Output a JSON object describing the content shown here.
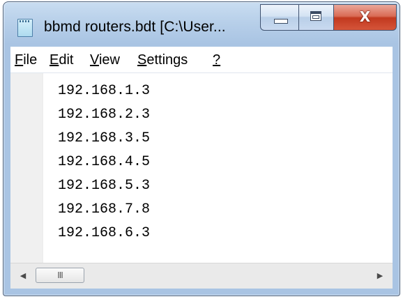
{
  "window": {
    "title": "bbmd routers.bdt [C:\\User..."
  },
  "caption": {
    "minimize_icon": "minimize-icon",
    "maximize_icon": "maximize-icon",
    "close_icon": "close-icon",
    "close_glyph": "X"
  },
  "menu": {
    "items": [
      {
        "mnemonic": "F",
        "rest": "ile"
      },
      {
        "mnemonic": "E",
        "rest": "dit"
      },
      {
        "mnemonic": "V",
        "rest": "iew"
      },
      {
        "mnemonic": "S",
        "rest": "ettings"
      },
      {
        "mnemonic": "?",
        "rest": ""
      }
    ]
  },
  "editor": {
    "lines": [
      "192.168.1.3",
      "192.168.2.3",
      "192.168.3.5",
      "192.168.4.5",
      "192.168.5.3",
      "192.168.7.8",
      "192.168.6.3"
    ]
  },
  "scrollbar": {
    "left_arrow": "◀",
    "right_arrow": "▶",
    "thumb_grip": "III"
  },
  "colors": {
    "title_bar": "#b7cfe9",
    "close_button": "#c2391f"
  }
}
